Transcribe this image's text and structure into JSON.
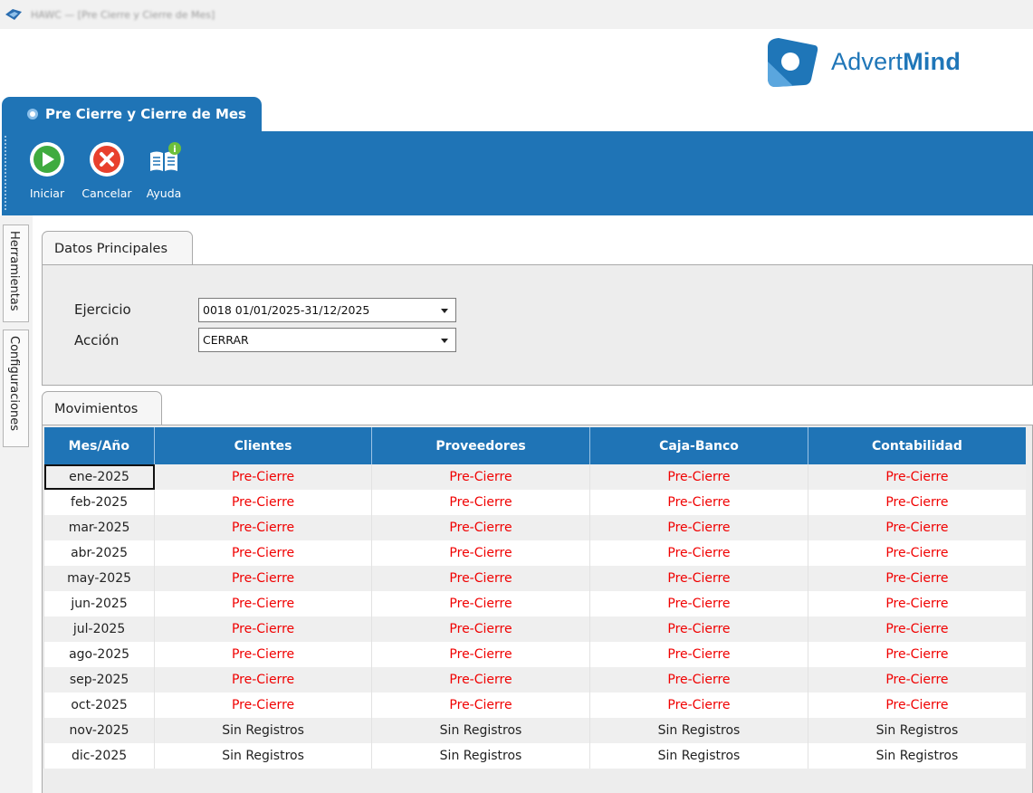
{
  "window": {
    "title": "HAWC — [Pre Cierre y Cierre de Mes]"
  },
  "brand": {
    "name_light": "Advert",
    "name_bold": "Mind",
    "accent": "#1f74b6"
  },
  "module_tab": {
    "label": "Pre Cierre y Cierre de Mes"
  },
  "toolbar": {
    "buttons": [
      {
        "label": "Iniciar",
        "icon": "play-icon"
      },
      {
        "label": "Cancelar",
        "icon": "cancel-x-icon"
      },
      {
        "label": "Ayuda",
        "icon": "help-book-icon"
      }
    ]
  },
  "side_tabs": {
    "tools": "Herramientas",
    "config": "Configuraciones"
  },
  "main_group": {
    "tab_label": "Datos Principales",
    "ejercicio_label": "Ejercicio",
    "ejercicio_value": "0018 01/01/2025-31/12/2025",
    "accion_label": "Acción",
    "accion_value": "CERRAR"
  },
  "movimientos": {
    "tab_label": "Movimientos",
    "columns": [
      "Mes/Año",
      "Clientes",
      "Proveedores",
      "Caja-Banco",
      "Contabilidad"
    ],
    "rows": [
      {
        "month": "ene-2025",
        "values": [
          "Pre-Cierre",
          "Pre-Cierre",
          "Pre-Cierre",
          "Pre-Cierre"
        ]
      },
      {
        "month": "feb-2025",
        "values": [
          "Pre-Cierre",
          "Pre-Cierre",
          "Pre-Cierre",
          "Pre-Cierre"
        ]
      },
      {
        "month": "mar-2025",
        "values": [
          "Pre-Cierre",
          "Pre-Cierre",
          "Pre-Cierre",
          "Pre-Cierre"
        ]
      },
      {
        "month": "abr-2025",
        "values": [
          "Pre-Cierre",
          "Pre-Cierre",
          "Pre-Cierre",
          "Pre-Cierre"
        ]
      },
      {
        "month": "may-2025",
        "values": [
          "Pre-Cierre",
          "Pre-Cierre",
          "Pre-Cierre",
          "Pre-Cierre"
        ]
      },
      {
        "month": "jun-2025",
        "values": [
          "Pre-Cierre",
          "Pre-Cierre",
          "Pre-Cierre",
          "Pre-Cierre"
        ]
      },
      {
        "month": "jul-2025",
        "values": [
          "Pre-Cierre",
          "Pre-Cierre",
          "Pre-Cierre",
          "Pre-Cierre"
        ]
      },
      {
        "month": "ago-2025",
        "values": [
          "Pre-Cierre",
          "Pre-Cierre",
          "Pre-Cierre",
          "Pre-Cierre"
        ]
      },
      {
        "month": "sep-2025",
        "values": [
          "Pre-Cierre",
          "Pre-Cierre",
          "Pre-Cierre",
          "Pre-Cierre"
        ]
      },
      {
        "month": "oct-2025",
        "values": [
          "Pre-Cierre",
          "Pre-Cierre",
          "Pre-Cierre",
          "Pre-Cierre"
        ]
      },
      {
        "month": "nov-2025",
        "values": [
          "Sin Registros",
          "Sin Registros",
          "Sin Registros",
          "Sin Registros"
        ]
      },
      {
        "month": "dic-2025",
        "values": [
          "Sin Registros",
          "Sin Registros",
          "Sin Registros",
          "Sin Registros"
        ]
      }
    ],
    "status_colors": {
      "Pre-Cierre": "#f00000",
      "Sin Registros": "#222222"
    }
  }
}
